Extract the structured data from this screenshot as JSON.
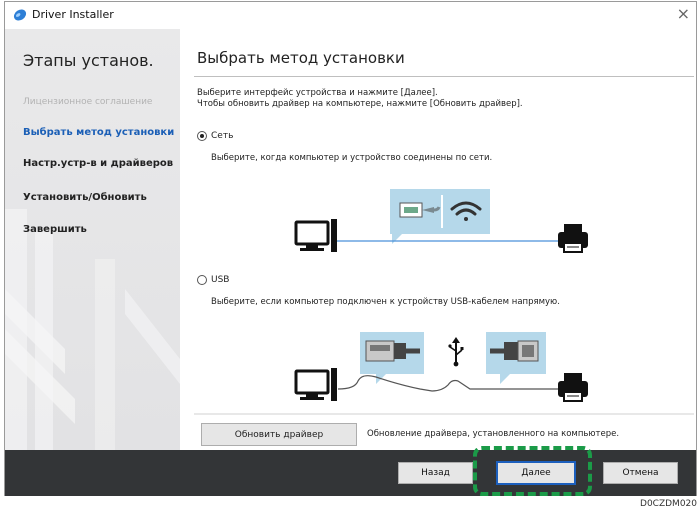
{
  "window": {
    "title": "Driver Installer",
    "close_glyph": "×"
  },
  "sidebar": {
    "title": "Этапы установ.",
    "steps": [
      {
        "label": "Лицензионное соглашение",
        "state": "done"
      },
      {
        "label": "Выбрать метод установки",
        "state": "active"
      },
      {
        "label": "Настр.устр-в и драйверов",
        "state": "pending"
      },
      {
        "label": "Установить/Обновить",
        "state": "pending"
      },
      {
        "label": "Завершить",
        "state": "pending"
      }
    ]
  },
  "main": {
    "title": "Выбрать метод установки",
    "instructions": [
      "Выберите интерфейс устройства и нажмите [Далее].",
      "Чтобы обновить драйвер на компьютере, нажмите [Обновить драйвер]."
    ],
    "options": [
      {
        "label": "Сеть",
        "checked": true,
        "description": "Выберите, когда компьютер и устройство соединены по сети."
      },
      {
        "label": "USB",
        "checked": false,
        "description": "Выберите, если компьютер подключен к устройству USB-кабелем напрямую."
      }
    ],
    "update_button": "Обновить драйвер",
    "update_description": "Обновление драйвера, установленного на компьютере."
  },
  "footer": {
    "back": "Назад",
    "next": "Далее",
    "cancel": "Отмена"
  },
  "figure_code": "D0CZDM020",
  "colors": {
    "accent": "#1b5fb6",
    "highlight": "#1b9b48",
    "footer_bg": "#333537",
    "diagram_panel": "#b5d8ea"
  },
  "icons": [
    "driver-installer-icon",
    "close-icon",
    "computer-icon",
    "printer-icon",
    "ethernet-cable-icon",
    "wifi-icon",
    "usb-symbol-icon",
    "usb-plug-a-icon",
    "usb-plug-b-icon"
  ]
}
